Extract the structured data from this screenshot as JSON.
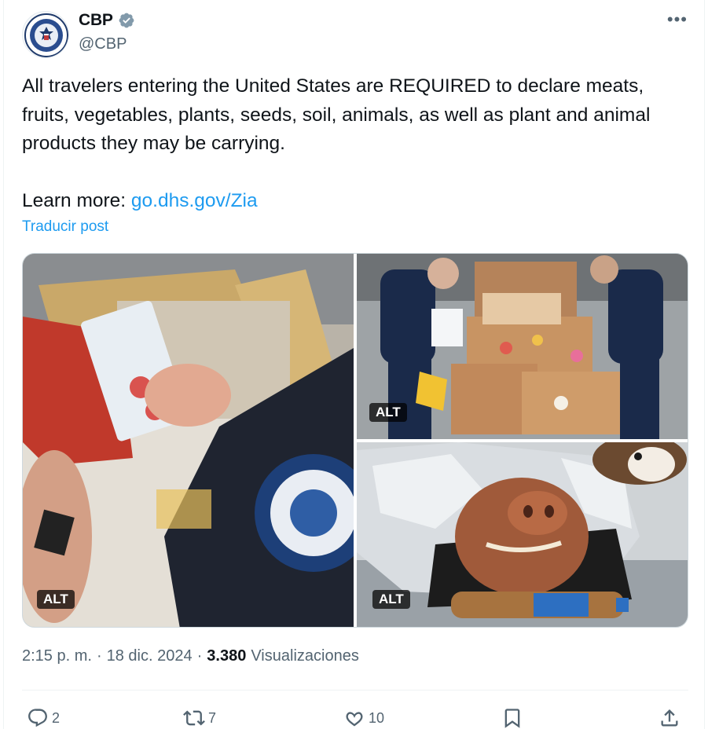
{
  "author": {
    "display_name": "CBP",
    "handle": "@CBP",
    "avatar_icon": "cbp-seal-icon",
    "verified_icon": "verified-badge-icon"
  },
  "post": {
    "text_paragraph": "All travelers entering the United States are REQUIRED to declare meats, fruits, vegetables, plants, seeds, soil, animals, as well as plant and animal products they may be carrying.",
    "learn_more_prefix": "Learn more: ",
    "learn_more_link": "go.dhs.gov/Zia",
    "translate_label": "Traducir post"
  },
  "media": [
    {
      "description": "officer-inspecting-food-package",
      "alt_label": "ALT"
    },
    {
      "description": "officers-inspecting-boxes-of-seized-food",
      "alt_label": "ALT"
    },
    {
      "description": "roasted-pig-head-in-foil-with-beagle",
      "alt_label": "ALT"
    }
  ],
  "meta": {
    "time": "2:15 p. m.",
    "separator": "·",
    "date": "18 dic. 2024",
    "views_count": "3.380",
    "views_label": "Visualizaciones"
  },
  "actions": {
    "replies": "2",
    "reposts": "7",
    "likes": "10"
  },
  "colors": {
    "link": "#1d9bf0",
    "secondary_text": "#536471",
    "primary_text": "#0f1419",
    "verified": "#829aab"
  }
}
